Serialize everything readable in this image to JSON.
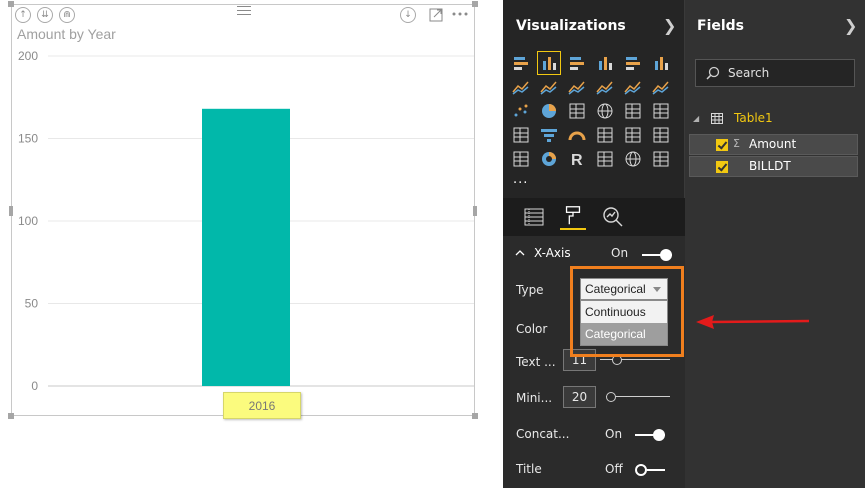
{
  "canvas": {
    "visual_title": "Amount by Year",
    "x_tooltip": "2016"
  },
  "chart_data": {
    "type": "bar",
    "title": "Amount by Year",
    "categories": [
      "2016"
    ],
    "values": [
      168
    ],
    "y_ticks": [
      0,
      50,
      100,
      150,
      200
    ],
    "ylim": [
      0,
      200
    ],
    "grid": true,
    "bar_color": "#01b8aa"
  },
  "visual_header": {
    "icons": [
      "drill-up-icon",
      "drill-down-icon",
      "expand-hierarchy-icon",
      "drill-mode-icon",
      "focus-mode-icon",
      "more-options-icon"
    ]
  },
  "visualizations": {
    "title": "Visualizations",
    "more": "...",
    "selected_icon_index": 1
  },
  "format": {
    "section_title": "X-Axis",
    "section_state": "On",
    "type_label": "Type",
    "type_value": "Categorical",
    "type_options": [
      "Continuous",
      "Categorical"
    ],
    "type_selected_option": "Categorical",
    "color_label": "Color",
    "text_size_label": "Text ...",
    "text_size_value": "11",
    "min_category_label": "Mini...",
    "min_category_value": "20",
    "concat_label": "Concat...",
    "concat_state": "On",
    "title_label": "Title",
    "title_state": "Off"
  },
  "fields": {
    "title": "Fields",
    "search_placeholder": "Search",
    "table_name": "Table1",
    "items": [
      {
        "name": "Amount",
        "type_glyph": "Σ"
      },
      {
        "name": "BILLDT",
        "type_glyph": ""
      }
    ]
  },
  "colors": {
    "accent": "#f2c811",
    "bar": "#01b8aa",
    "annotation_box": "#f07f1e",
    "annotation_arrow": "#e31b1b"
  }
}
